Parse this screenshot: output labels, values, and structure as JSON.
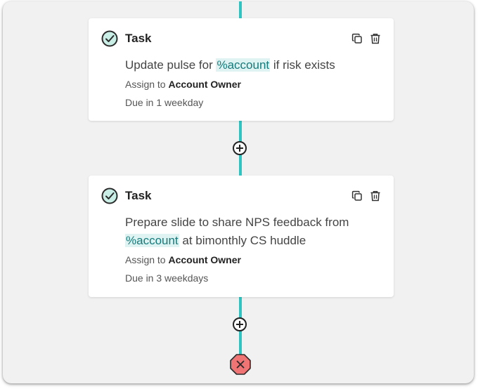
{
  "colors": {
    "connector": "#2fc4c1",
    "token_text": "#137a7b",
    "token_bg": "#dff4f2",
    "check_fill": "#c9eee6",
    "end_node": "#f07474"
  },
  "tasks": [
    {
      "type_label": "Task",
      "desc_before": "Update pulse for ",
      "token": "%account",
      "desc_after": " if risk exists",
      "assign_prefix": "Assign to ",
      "assignee": "Account Owner",
      "due": "Due in 1 weekday"
    },
    {
      "type_label": "Task",
      "desc_before": "Prepare slide to share NPS feedback from ",
      "token": "%account",
      "desc_after": " at bimonthly CS huddle",
      "assign_prefix": "Assign to ",
      "assignee": "Account Owner",
      "due": "Due in 3 weekdays"
    }
  ],
  "icons": {
    "check": "check-circle-icon",
    "copy": "copy-icon",
    "trash": "trash-icon",
    "add": "plus-circle-icon",
    "end": "close-octagon-icon"
  }
}
